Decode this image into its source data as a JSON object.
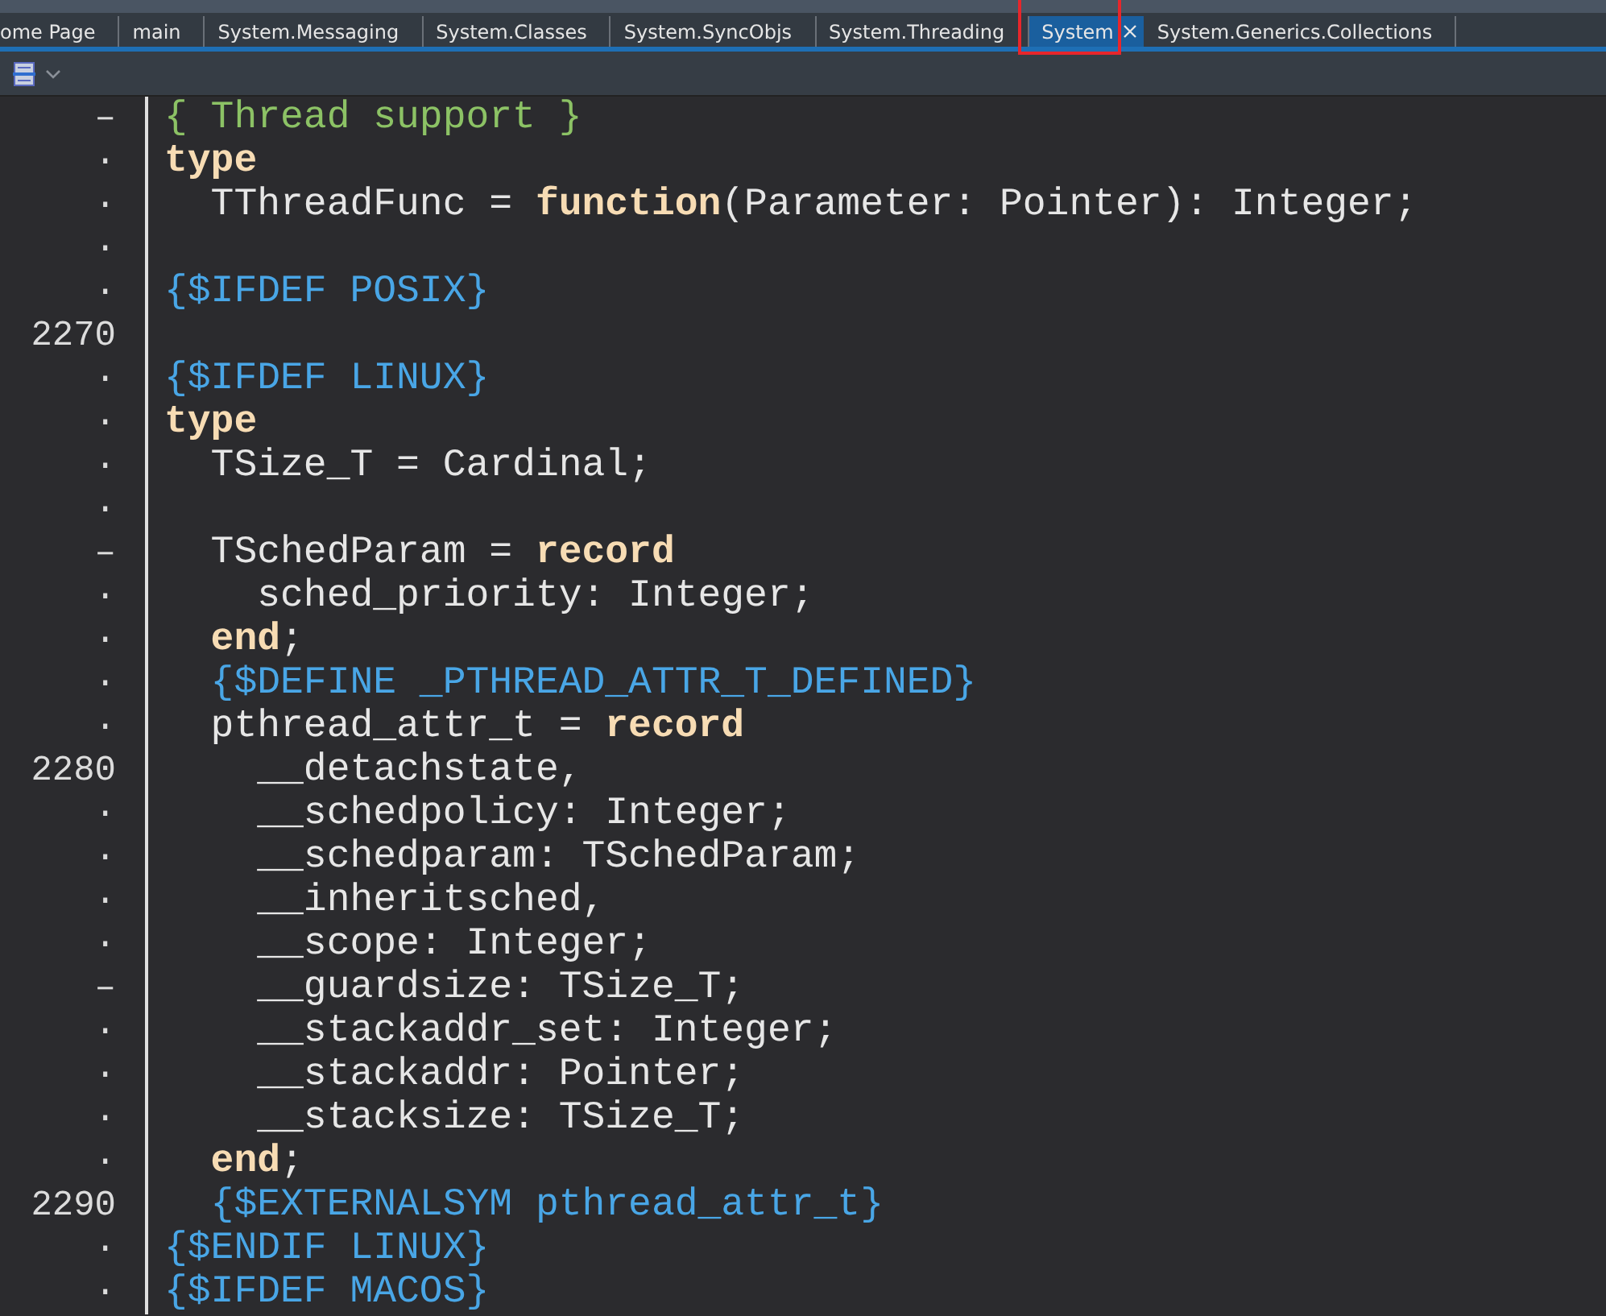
{
  "tabs": [
    {
      "label": "ome Page",
      "selected": false,
      "annotated": false
    },
    {
      "label": "main",
      "selected": false,
      "annotated": false
    },
    {
      "label": "System.Messaging",
      "selected": false,
      "annotated": false
    },
    {
      "label": "System.Classes",
      "selected": false,
      "annotated": false
    },
    {
      "label": "System.SyncObjs",
      "selected": false,
      "annotated": false
    },
    {
      "label": "System.Threading",
      "selected": false,
      "annotated": false
    },
    {
      "label": "System",
      "selected": true,
      "annotated": true
    },
    {
      "label": "System.Generics.Collections",
      "selected": false,
      "annotated": false
    }
  ],
  "editor": {
    "lines": [
      {
        "gutter": "–",
        "tokens": [
          {
            "kind": "comment",
            "text": "{ Thread support }"
          }
        ]
      },
      {
        "gutter": "·",
        "tokens": [
          {
            "kind": "keyword",
            "text": "type"
          }
        ]
      },
      {
        "gutter": "·",
        "tokens": [
          {
            "kind": "plain",
            "text": "  TThreadFunc = "
          },
          {
            "kind": "keyword",
            "text": "function"
          },
          {
            "kind": "plain",
            "text": "(Parameter: Pointer): Integer;"
          }
        ]
      },
      {
        "gutter": "·"
      },
      {
        "gutter": "·",
        "tokens": [
          {
            "kind": "directive",
            "text": "{$IFDEF POSIX}"
          }
        ]
      },
      {
        "gutter": "2270"
      },
      {
        "gutter": "·",
        "tokens": [
          {
            "kind": "directive",
            "text": "{$IFDEF LINUX}"
          }
        ]
      },
      {
        "gutter": "·",
        "tokens": [
          {
            "kind": "keyword",
            "text": "type"
          }
        ]
      },
      {
        "gutter": "·",
        "tokens": [
          {
            "kind": "plain",
            "text": "  TSize_T = Cardinal;"
          }
        ]
      },
      {
        "gutter": "·"
      },
      {
        "gutter": "–",
        "tokens": [
          {
            "kind": "plain",
            "text": "  TSchedParam = "
          },
          {
            "kind": "keyword",
            "text": "record"
          }
        ]
      },
      {
        "gutter": "·",
        "tokens": [
          {
            "kind": "plain",
            "text": "    sched_priority: Integer;"
          }
        ]
      },
      {
        "gutter": "·",
        "tokens": [
          {
            "kind": "keyword",
            "text": "  end"
          },
          {
            "kind": "plain",
            "text": ";"
          }
        ]
      },
      {
        "gutter": "·",
        "tokens": [
          {
            "kind": "directive",
            "text": "  {$DEFINE _PTHREAD_ATTR_T_DEFINED}"
          }
        ]
      },
      {
        "gutter": "·",
        "tokens": [
          {
            "kind": "plain",
            "text": "  pthread_attr_t = "
          },
          {
            "kind": "keyword",
            "text": "record"
          }
        ]
      },
      {
        "gutter": "2280",
        "tokens": [
          {
            "kind": "plain",
            "text": "    __detachstate,"
          }
        ]
      },
      {
        "gutter": "·",
        "tokens": [
          {
            "kind": "plain",
            "text": "    __schedpolicy: Integer;"
          }
        ]
      },
      {
        "gutter": "·",
        "tokens": [
          {
            "kind": "plain",
            "text": "    __schedparam: TSchedParam;"
          }
        ]
      },
      {
        "gutter": "·",
        "tokens": [
          {
            "kind": "plain",
            "text": "    __inheritsched,"
          }
        ]
      },
      {
        "gutter": "·",
        "tokens": [
          {
            "kind": "plain",
            "text": "    __scope: Integer;"
          }
        ]
      },
      {
        "gutter": "–",
        "tokens": [
          {
            "kind": "plain",
            "text": "    __guardsize: TSize_T;"
          }
        ]
      },
      {
        "gutter": "·",
        "tokens": [
          {
            "kind": "plain",
            "text": "    __stackaddr_set: Integer;"
          }
        ]
      },
      {
        "gutter": "·",
        "tokens": [
          {
            "kind": "plain",
            "text": "    __stackaddr: Pointer;"
          }
        ]
      },
      {
        "gutter": "·",
        "tokens": [
          {
            "kind": "plain",
            "text": "    __stacksize: TSize_T;"
          }
        ]
      },
      {
        "gutter": "·",
        "tokens": [
          {
            "kind": "keyword",
            "text": "  end"
          },
          {
            "kind": "plain",
            "text": ";"
          }
        ]
      },
      {
        "gutter": "2290",
        "tokens": [
          {
            "kind": "directive",
            "text": "  {$EXTERNALSYM pthread_attr_t}"
          }
        ]
      },
      {
        "gutter": "·",
        "tokens": [
          {
            "kind": "directive",
            "text": "{$ENDIF LINUX}"
          }
        ]
      },
      {
        "gutter": "·",
        "tokens": [
          {
            "kind": "directive",
            "text": "{$IFDEF MACOS}"
          }
        ]
      }
    ]
  }
}
